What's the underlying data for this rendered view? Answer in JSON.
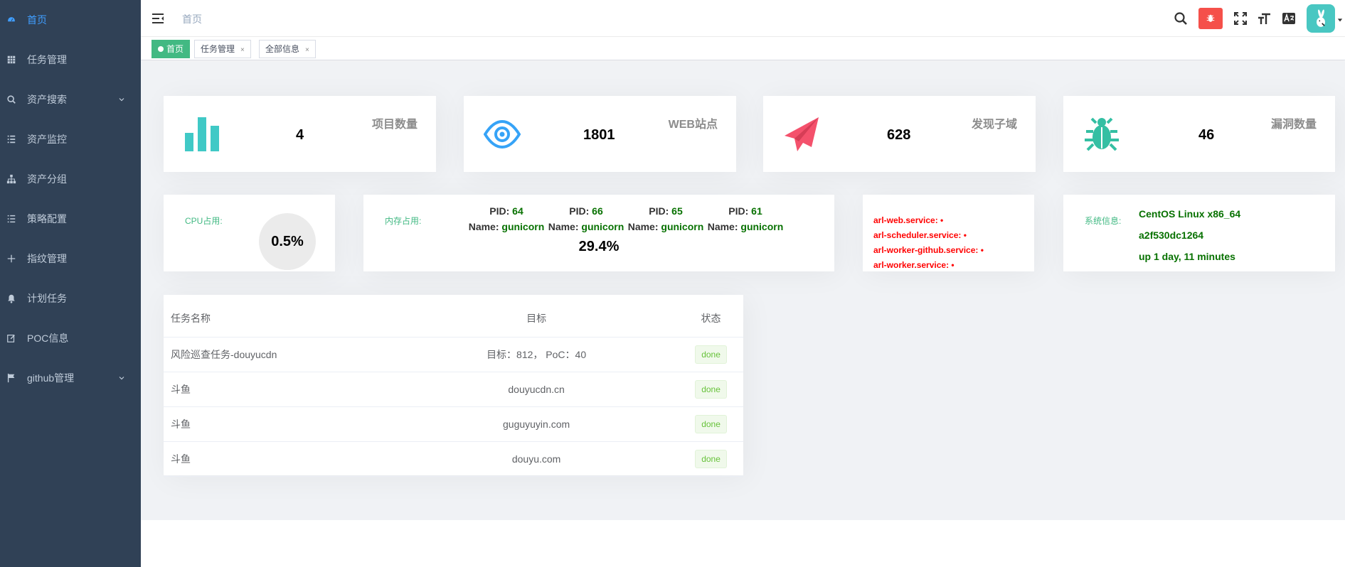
{
  "sidebar": {
    "items": [
      {
        "label": "首页",
        "icon": "dashboard-icon"
      },
      {
        "label": "任务管理",
        "icon": "table-icon"
      },
      {
        "label": "资产搜索",
        "icon": "search-icon"
      },
      {
        "label": "资产监控",
        "icon": "list-icon"
      },
      {
        "label": "资产分组",
        "icon": "tree-icon"
      },
      {
        "label": "策略配置",
        "icon": "list-icon"
      },
      {
        "label": "指纹管理",
        "icon": "plus-icon"
      },
      {
        "label": "计划任务",
        "icon": "bell-icon"
      },
      {
        "label": "POC信息",
        "icon": "edit-icon"
      },
      {
        "label": "github管理",
        "icon": "flag-icon"
      }
    ]
  },
  "navbar": {
    "breadcrumb": "首页"
  },
  "tags": [
    {
      "label": "首页",
      "active": true
    },
    {
      "label": "任务管理",
      "close": "×"
    },
    {
      "label": "全部信息",
      "close": "×"
    }
  ],
  "stats": [
    {
      "title": "项目数量",
      "value": "4",
      "icon": "bar-chart-icon",
      "color": "#40c9c6"
    },
    {
      "title": "WEB站点",
      "value": "1801",
      "icon": "eye-icon",
      "color": "#36a3f7"
    },
    {
      "title": "发现子域",
      "value": "628",
      "icon": "paper-plane-icon",
      "color": "#f4516c"
    },
    {
      "title": "漏洞数量",
      "value": "46",
      "icon": "bug-icon",
      "color": "#34bfa3"
    }
  ],
  "cpu": {
    "label": "CPU占用:",
    "value": "0.5%"
  },
  "memory": {
    "label": "内存占用:",
    "processes": [
      {
        "pid_label": "PID:",
        "pid": "64",
        "name_label": "Name:",
        "name": "gunicorn"
      },
      {
        "pid_label": "PID:",
        "pid": "66",
        "name_label": "Name:",
        "name": "gunicorn"
      },
      {
        "pid_label": "PID:",
        "pid": "65",
        "name_label": "Name:",
        "name": "gunicorn"
      },
      {
        "pid_label": "PID:",
        "pid": "61",
        "name_label": "Name:",
        "name": "gunicorn"
      }
    ],
    "value": "29.4%"
  },
  "services": [
    "arl-web.service: •",
    "arl-scheduler.service: •",
    "arl-worker-github.service: •",
    "arl-worker.service: •"
  ],
  "system": {
    "label": "系统信息:",
    "lines": [
      "CentOS Linux x86_64",
      "a2f530dc1264",
      "up 1 day, 11 minutes"
    ]
  },
  "table": {
    "headers": [
      "任务名称",
      "目标",
      "状态"
    ],
    "rows": [
      {
        "name": "风险巡查任务-douyucdn",
        "target": "目标：812， PoC：40",
        "status": "done"
      },
      {
        "name": "斗鱼",
        "target": "douyucdn.cn",
        "status": "done"
      },
      {
        "name": "斗鱼",
        "target": "guguyuyin.com",
        "status": "done"
      },
      {
        "name": "斗鱼",
        "target": "douyu.com",
        "status": "done"
      }
    ]
  },
  "colors": {
    "sidebar_bg": "#304156",
    "accent": "#409eff",
    "tag_active": "#42b983",
    "green_text": "#077100",
    "service_red": "#ff0000"
  }
}
